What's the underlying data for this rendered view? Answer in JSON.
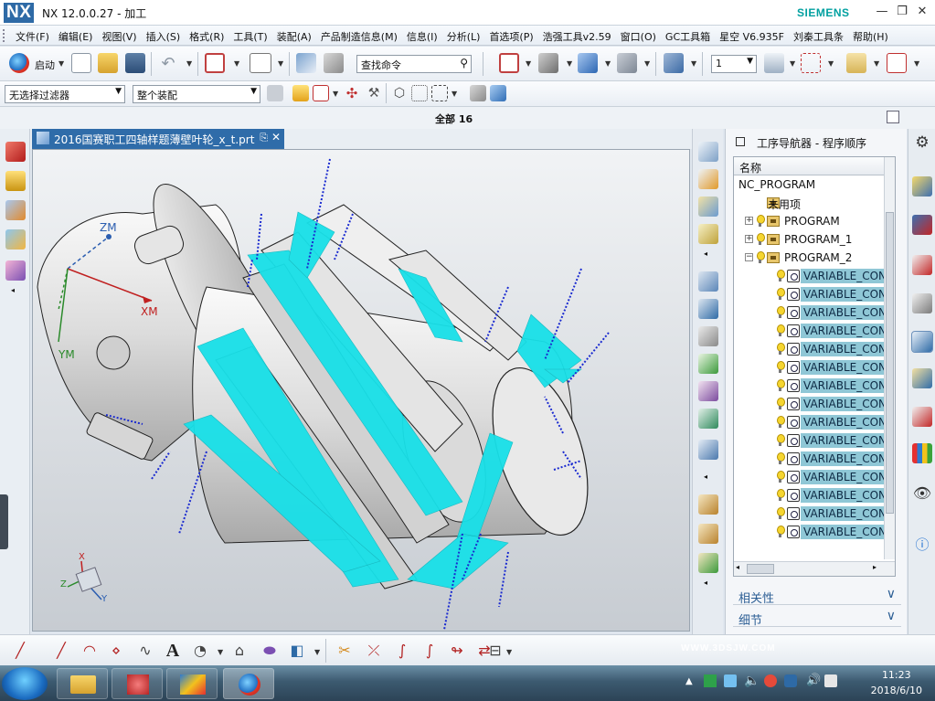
{
  "titlebar": {
    "logo": "NX",
    "title": "NX 12.0.0.27 - 加工",
    "brand": "SIEMENS",
    "minimize": "—",
    "restore": "❐",
    "close": "✕"
  },
  "menu": [
    "文件(F)",
    "编辑(E)",
    "视图(V)",
    "插入(S)",
    "格式(R)",
    "工具(T)",
    "装配(A)",
    "产品制造信息(M)",
    "信息(I)",
    "分析(L)",
    "首选项(P)",
    "浩强工具v2.59",
    "窗口(O)",
    "GC工具箱",
    "星空 V6.935F",
    "刘秦工具条",
    "帮助(H)"
  ],
  "toolbar": {
    "start_label": "启动",
    "command_search_placeholder": "查找命令",
    "layer_value": "1"
  },
  "filters": {
    "selection_filter": "无选择过滤器",
    "assembly_scope": "整个装配"
  },
  "view": {
    "all_label": "全部 16"
  },
  "document": {
    "tab_label": "2016国赛职工四轴样题薄壁叶轮_x_t.prt"
  },
  "viewport": {
    "axis_z": "ZM",
    "axis_x": "XM",
    "axis_y": "YM",
    "triad_x": "X",
    "triad_y": "Y",
    "triad_z": "Z"
  },
  "navigator": {
    "title": "工序导航器 - 程序顺序",
    "column_name": "名称",
    "tree": [
      {
        "label": "NC_PROGRAM",
        "level": 0,
        "type": "root"
      },
      {
        "label": "未用项",
        "level": 1,
        "type": "folder"
      },
      {
        "label": "PROGRAM",
        "level": 1,
        "type": "program",
        "expander": "+"
      },
      {
        "label": "PROGRAM_1",
        "level": 1,
        "type": "program",
        "expander": "+"
      },
      {
        "label": "PROGRAM_2",
        "level": 1,
        "type": "program",
        "expander": "−"
      },
      {
        "label": "VARIABLE_CONT",
        "level": 2,
        "type": "operation",
        "selected": true
      },
      {
        "label": "VARIABLE_CONT",
        "level": 2,
        "type": "operation",
        "selected": true
      },
      {
        "label": "VARIABLE_CONT",
        "level": 2,
        "type": "operation",
        "selected": true
      },
      {
        "label": "VARIABLE_CONT",
        "level": 2,
        "type": "operation",
        "selected": true
      },
      {
        "label": "VARIABLE_CONT",
        "level": 2,
        "type": "operation",
        "selected": true
      },
      {
        "label": "VARIABLE_CONT",
        "level": 2,
        "type": "operation",
        "selected": true
      },
      {
        "label": "VARIABLE_CONT",
        "level": 2,
        "type": "operation",
        "selected": true
      },
      {
        "label": "VARIABLE_CONT",
        "level": 2,
        "type": "operation",
        "selected": true
      },
      {
        "label": "VARIABLE_CONT",
        "level": 2,
        "type": "operation",
        "selected": true
      },
      {
        "label": "VARIABLE_CONT",
        "level": 2,
        "type": "operation",
        "selected": true
      },
      {
        "label": "VARIABLE_CONT",
        "level": 2,
        "type": "operation",
        "selected": true
      },
      {
        "label": "VARIABLE_CONT",
        "level": 2,
        "type": "operation",
        "selected": true
      },
      {
        "label": "VARIABLE_CONT",
        "level": 2,
        "type": "operation",
        "selected": true
      },
      {
        "label": "VARIABLE_CONT",
        "level": 2,
        "type": "operation",
        "selected": true
      },
      {
        "label": "VARIABLE_CONT",
        "level": 2,
        "type": "operation",
        "selected": true
      }
    ],
    "panels": [
      "相关性",
      "细节"
    ]
  },
  "taskbar": {
    "time": "11:23",
    "date": "2018/6/10"
  },
  "watermark": "WWW.3DSJW.COM",
  "colors": {
    "toolpath": "#18e0e8",
    "title_tab": "#2f6ca9",
    "selection": "#8fc7d6"
  }
}
